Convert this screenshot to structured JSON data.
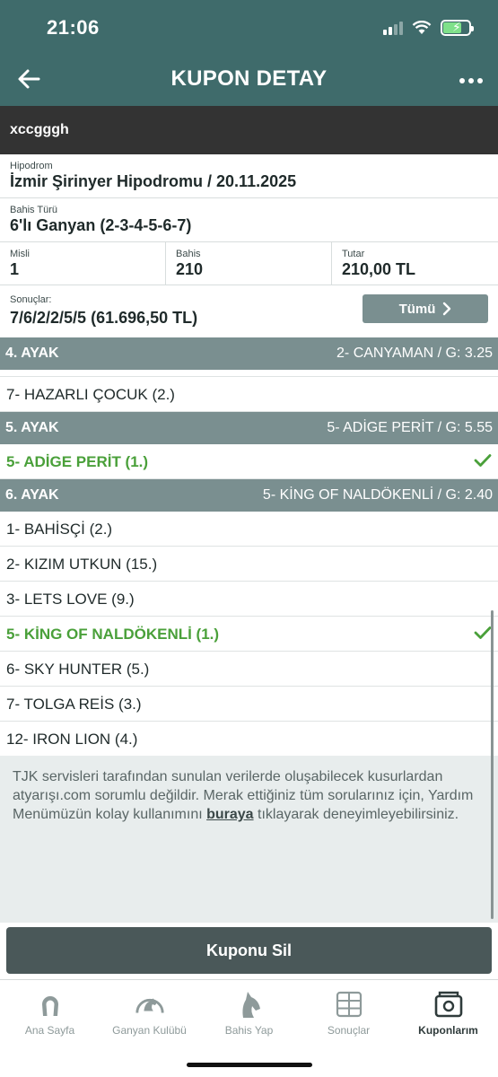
{
  "status_bar": {
    "time": "21:06"
  },
  "header": {
    "title": "KUPON DETAY",
    "back_icon": "arrow-left-icon",
    "more_icon": "more-dots-icon"
  },
  "coupon_name": "xccgggh",
  "hipodrom": {
    "label": "Hipodrom",
    "value": "İzmir Şirinyer Hipodromu / 20.11.2025"
  },
  "bet_type": {
    "label": "Bahis Türü",
    "value": "6'lı Ganyan (2-3-4-5-6-7)"
  },
  "stats": [
    {
      "label": "Misli",
      "value": "1"
    },
    {
      "label": "Bahis",
      "value": "210"
    },
    {
      "label": "Tutar",
      "value": "210,00 TL"
    }
  ],
  "results": {
    "label": "Sonuçlar:",
    "value": "7/6/2/2/5/5 (61.696,50 TL)",
    "all_button": "Tümü"
  },
  "legs": [
    {
      "title": "4. AYAK",
      "winner": "2- CANYAMAN / G: 3.25",
      "runners": [
        {
          "name": "7- HAZARLI ÇOCUK (2.)",
          "won": false
        }
      ]
    },
    {
      "title": "5. AYAK",
      "winner": "5- ADİGE PERİT / G: 5.55",
      "runners": [
        {
          "name": "5- ADİGE PERİT (1.)",
          "won": true
        }
      ]
    },
    {
      "title": "6. AYAK",
      "winner": "5- KİNG OF NALDÖKENLİ / G: 2.40",
      "runners": [
        {
          "name": "1- BAHİSÇİ (2.)",
          "won": false
        },
        {
          "name": "2- KIZIM UTKUN (15.)",
          "won": false
        },
        {
          "name": "3- LETS LOVE (9.)",
          "won": false
        },
        {
          "name": "5- KİNG OF NALDÖKENLİ (1.)",
          "won": true
        },
        {
          "name": "6- SKY HUNTER (5.)",
          "won": false
        },
        {
          "name": "7- TOLGA REİS (3.)",
          "won": false
        },
        {
          "name": "12- IRON LION (4.)",
          "won": false
        }
      ]
    }
  ],
  "disclaimer": {
    "before": "TJK servisleri tarafından sunulan verilerde oluşabilecek kusurlardan atyarışı.com sorumlu değildir. Merak ettiğiniz tüm sorularınız için, Yardım Menümüzün kolay kullanımını ",
    "link": "buraya",
    "after": " tıklayarak deneyimleyebilirsiniz."
  },
  "delete_button": "Kuponu Sil",
  "tabs": [
    {
      "label": "Ana Sayfa",
      "icon": "horseshoe-icon",
      "active": false
    },
    {
      "label": "Ganyan Kulübü",
      "icon": "horse-gauge-icon",
      "active": false
    },
    {
      "label": "Bahis Yap",
      "icon": "horse-head-icon",
      "active": false
    },
    {
      "label": "Sonuçlar",
      "icon": "results-grid-icon",
      "active": false
    },
    {
      "label": "Kuponlarım",
      "icon": "coupon-icon",
      "active": true
    }
  ],
  "colors": {
    "header": "#3f6b6b",
    "leg_header": "#7a8f90",
    "winner": "#4aa03a",
    "name_bar": "#333333"
  }
}
